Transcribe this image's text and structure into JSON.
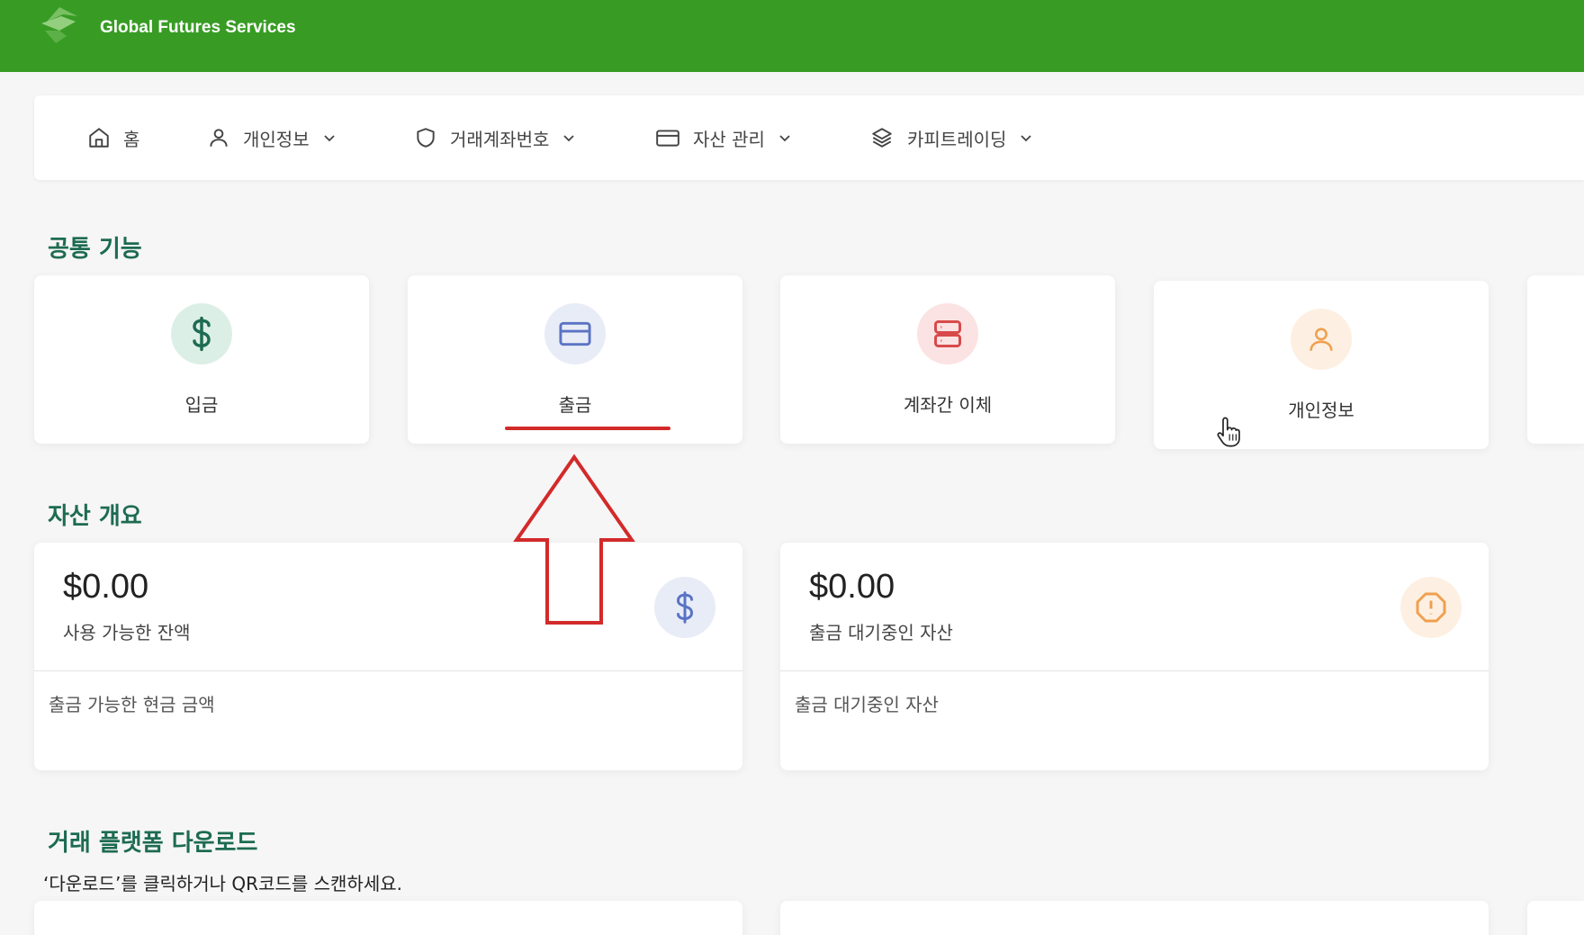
{
  "header": {
    "brand": "Global Futures Services"
  },
  "nav": {
    "items": [
      {
        "label": "홈",
        "icon": "home-icon",
        "dropdown": false
      },
      {
        "label": "개인정보",
        "icon": "user-icon",
        "dropdown": true
      },
      {
        "label": "거래계좌번호",
        "icon": "shield-icon",
        "dropdown": true
      },
      {
        "label": "자산 관리",
        "icon": "credit-card-icon",
        "dropdown": true
      },
      {
        "label": "카피트레이딩",
        "icon": "layers-icon",
        "dropdown": true
      }
    ]
  },
  "sections": {
    "common": "공통 기능",
    "assets": "자산 개요",
    "download": "거래 플랫폼 다운로드"
  },
  "quick_actions": [
    {
      "label": "입금",
      "icon": "dollar-icon",
      "color": "#1d6b52",
      "bg": "#dcefe6"
    },
    {
      "label": "출금",
      "icon": "card-icon",
      "color": "#5a73c4",
      "bg": "#e8ecf7"
    },
    {
      "label": "계좌간 이체",
      "icon": "server-icon",
      "color": "#d84a4a",
      "bg": "#fbe3e3"
    },
    {
      "label": "개인정보",
      "icon": "user-icon",
      "color": "#f0a050",
      "bg": "#fdf0e2"
    }
  ],
  "asset_cards": [
    {
      "amount": "$0.00",
      "sub": "사용 가능한 잔액",
      "foot": "출금 가능한 현금 금액",
      "icon": "dollar-icon",
      "color": "#5a73c4",
      "bg": "#e8ecf7"
    },
    {
      "amount": "$0.00",
      "sub": "출금 대기중인 자산",
      "foot": "출금 대기중인 자산",
      "icon": "alert-octagon-icon",
      "color": "#f0a050",
      "bg": "#fdf0e2"
    }
  ],
  "download": {
    "description": "‘다운로드’를 클릭하거나 QR코드를 스캔하세요."
  },
  "colors": {
    "header_green": "#389c24",
    "section_title": "#1d6b52",
    "annotation_red": "#d32a2a"
  }
}
